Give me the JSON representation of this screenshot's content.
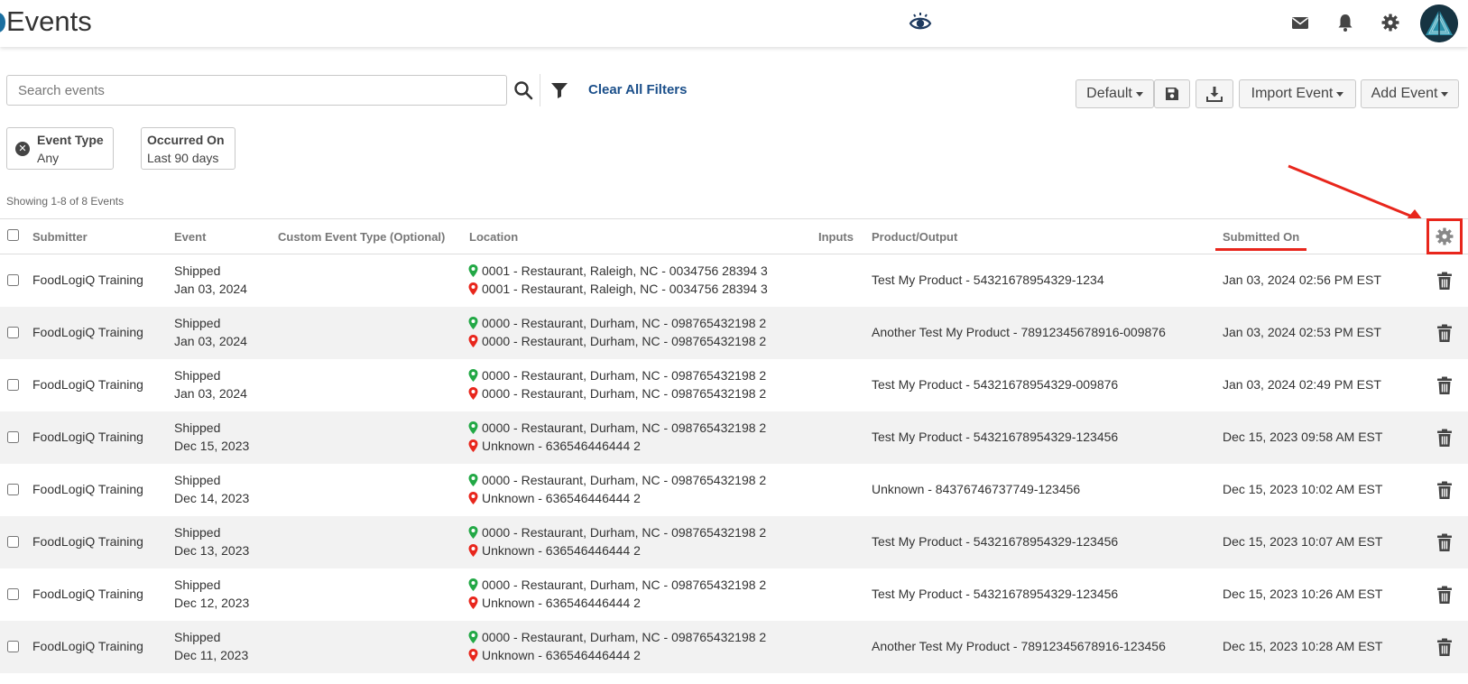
{
  "header": {
    "title": "Events",
    "icons": [
      "eye-icon",
      "mail-icon",
      "bell-icon",
      "gear-icon",
      "avatar"
    ]
  },
  "toolbar": {
    "search_placeholder": "Search events",
    "clear_filters": "Clear All Filters",
    "view_select": "Default",
    "import_label": "Import Event",
    "add_label": "Add Event"
  },
  "filters": [
    {
      "label": "Event Type",
      "value": "Any",
      "removable": true
    },
    {
      "label": "Occurred On",
      "value": "Last 90 days",
      "removable": false
    }
  ],
  "showing": "Showing 1-8 of 8 Events",
  "columns": {
    "submitter": "Submitter",
    "event": "Event",
    "custom_event_type": "Custom Event Type (Optional)",
    "location": "Location",
    "inputs": "Inputs",
    "product_output": "Product/Output",
    "submitted_on": "Submitted On"
  },
  "rows": [
    {
      "submitter": "FoodLogiQ Training",
      "event": "Shipped",
      "event_date": "Jan 03, 2024",
      "loc_from": "0001 - Restaurant, Raleigh, NC - 0034756 28394 3",
      "loc_to": "0001 - Restaurant, Raleigh, NC - 0034756 28394 3",
      "product": "Test My Product - 54321678954329-1234",
      "submitted_on": "Jan 03, 2024 02:56 PM EST"
    },
    {
      "submitter": "FoodLogiQ Training",
      "event": "Shipped",
      "event_date": "Jan 03, 2024",
      "loc_from": "0000 - Restaurant, Durham, NC - 098765432198 2",
      "loc_to": "0000 - Restaurant, Durham, NC - 098765432198 2",
      "product": "Another Test My Product - 78912345678916-009876",
      "submitted_on": "Jan 03, 2024 02:53 PM EST"
    },
    {
      "submitter": "FoodLogiQ Training",
      "event": "Shipped",
      "event_date": "Jan 03, 2024",
      "loc_from": "0000 - Restaurant, Durham, NC - 098765432198 2",
      "loc_to": "0000 - Restaurant, Durham, NC - 098765432198 2",
      "product": "Test My Product - 54321678954329-009876",
      "submitted_on": "Jan 03, 2024 02:49 PM EST"
    },
    {
      "submitter": "FoodLogiQ Training",
      "event": "Shipped",
      "event_date": "Dec 15, 2023",
      "loc_from": "0000 - Restaurant, Durham, NC - 098765432198 2",
      "loc_to": "Unknown - 636546446444 2",
      "product": "Test My Product - 54321678954329-123456",
      "submitted_on": "Dec 15, 2023 09:58 AM EST"
    },
    {
      "submitter": "FoodLogiQ Training",
      "event": "Shipped",
      "event_date": "Dec 14, 2023",
      "loc_from": "0000 - Restaurant, Durham, NC - 098765432198 2",
      "loc_to": "Unknown - 636546446444 2",
      "product": "Unknown - 84376746737749-123456",
      "submitted_on": "Dec 15, 2023 10:02 AM EST"
    },
    {
      "submitter": "FoodLogiQ Training",
      "event": "Shipped",
      "event_date": "Dec 13, 2023",
      "loc_from": "0000 - Restaurant, Durham, NC - 098765432198 2",
      "loc_to": "Unknown - 636546446444 2",
      "product": "Test My Product - 54321678954329-123456",
      "submitted_on": "Dec 15, 2023 10:07 AM EST"
    },
    {
      "submitter": "FoodLogiQ Training",
      "event": "Shipped",
      "event_date": "Dec 12, 2023",
      "loc_from": "0000 - Restaurant, Durham, NC - 098765432198 2",
      "loc_to": "Unknown - 636546446444 2",
      "product": "Test My Product - 54321678954329-123456",
      "submitted_on": "Dec 15, 2023 10:26 AM EST"
    },
    {
      "submitter": "FoodLogiQ Training",
      "event": "Shipped",
      "event_date": "Dec 11, 2023",
      "loc_from": "0000 - Restaurant, Durham, NC - 098765432198 2",
      "loc_to": "Unknown - 636546446444 2",
      "product": "Another Test My Product - 78912345678916-123456",
      "submitted_on": "Dec 15, 2023 10:28 AM EST"
    }
  ],
  "colors": {
    "accent_link": "#1b4f8a",
    "annotation_red": "#e8261c",
    "pin_origin": "#22a845",
    "pin_destination": "#e8261c",
    "row_alt": "#f2f2f2"
  }
}
